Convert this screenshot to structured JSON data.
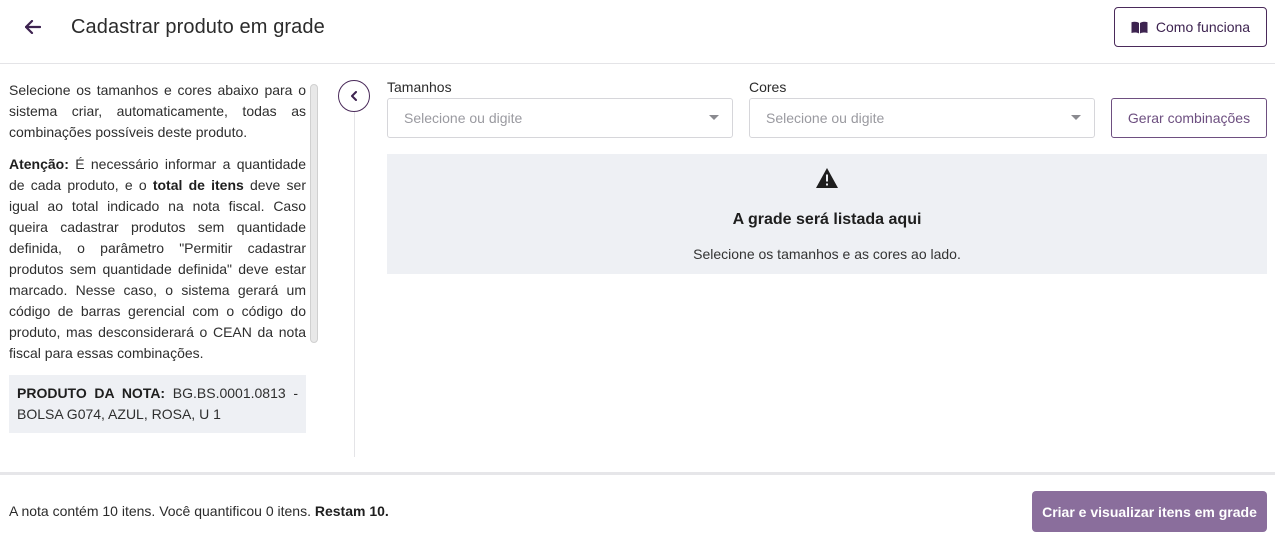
{
  "header": {
    "title": "Cadastrar produto em grade",
    "back_icon": "arrow-left-icon",
    "help_button": {
      "label": "Como funciona",
      "icon": "open-book-icon"
    }
  },
  "sidebar": {
    "intro": "Selecione os tamanhos e cores abaixo para o sistema criar, automaticamente, todas as combinações possíveis deste produto.",
    "attention_label": "Atenção:",
    "attention_text_1": " É necessário informar a quantidade de cada produto, e o ",
    "attention_bold": "total de itens",
    "attention_text_2": " deve ser igual ao total indicado na nota fiscal. Caso queira cadastrar produtos sem quantidade definida, o parâmetro \"Permitir cadastrar produtos sem quantidade definida\" deve estar marcado. Nesse caso, o sistema gerará um código de barras gerencial com o código do produto, mas desconsiderará o CEAN da nota fiscal para essas combinações.",
    "product_label": "PRODUTO DA NOTA:",
    "product_value": " BG.BS.0001.0813 - BOLSA G074, AZUL, ROSA, U 1",
    "collapse_icon": "chevron-left-icon"
  },
  "form": {
    "sizes_label": "Tamanhos",
    "sizes_placeholder": "Selecione ou digite",
    "colors_label": "Cores",
    "colors_placeholder": "Selecione ou digite",
    "generate_button": "Gerar combinações"
  },
  "empty_state": {
    "icon": "warning-triangle-icon",
    "title": "A grade será listada aqui",
    "subtitle": "Selecione os tamanhos e as cores ao lado."
  },
  "footer": {
    "status_text": "A nota contém 10 itens. Você quantificou 0 itens. ",
    "status_bold": "Restam 10.",
    "create_button": "Criar e visualizar itens em grade"
  },
  "colors": {
    "accent": "#4a2a5a",
    "primary_button": "#8a6e9c",
    "panel_bg": "#eef0f4"
  }
}
